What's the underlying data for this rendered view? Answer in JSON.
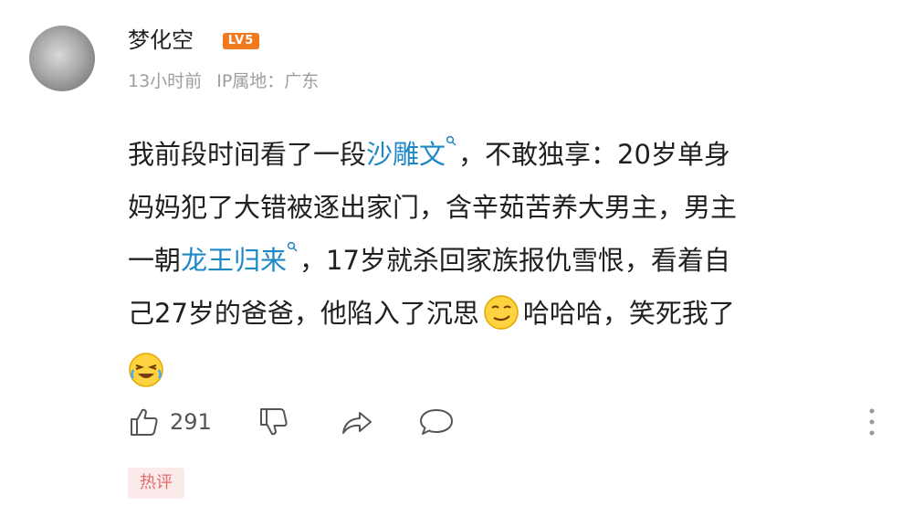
{
  "user": {
    "name": "梦化空",
    "level_badge": "LV5"
  },
  "meta": {
    "time": "13小时前",
    "ip_location": "IP属地：广东"
  },
  "comment": {
    "seg1": "我前段时间看了一段",
    "link1": "沙雕文",
    "seg2": "，不敢独享：20岁单身",
    "seg3": "妈妈犯了大错被逐出家门，含辛茹苦养大男主，男主",
    "seg4": "一朝",
    "link2": "龙王归来",
    "seg5": "，17岁就杀回家族报仇雪恨，看着自",
    "seg6": "己27岁的爸爸，他陷入了沉思",
    "seg7": "哈哈哈，笑死我了"
  },
  "emojis": [
    "smirk-emoji",
    "laugh-cry-emoji"
  ],
  "actions": {
    "like_count": "291"
  },
  "tags": {
    "hot": "热评"
  },
  "colors": {
    "link": "#1e88c6",
    "badge": "#f07a1d",
    "hot_tag_bg": "#fbeaea",
    "hot_tag_text": "#e56b6b",
    "meta_text": "#9e9e9e"
  }
}
